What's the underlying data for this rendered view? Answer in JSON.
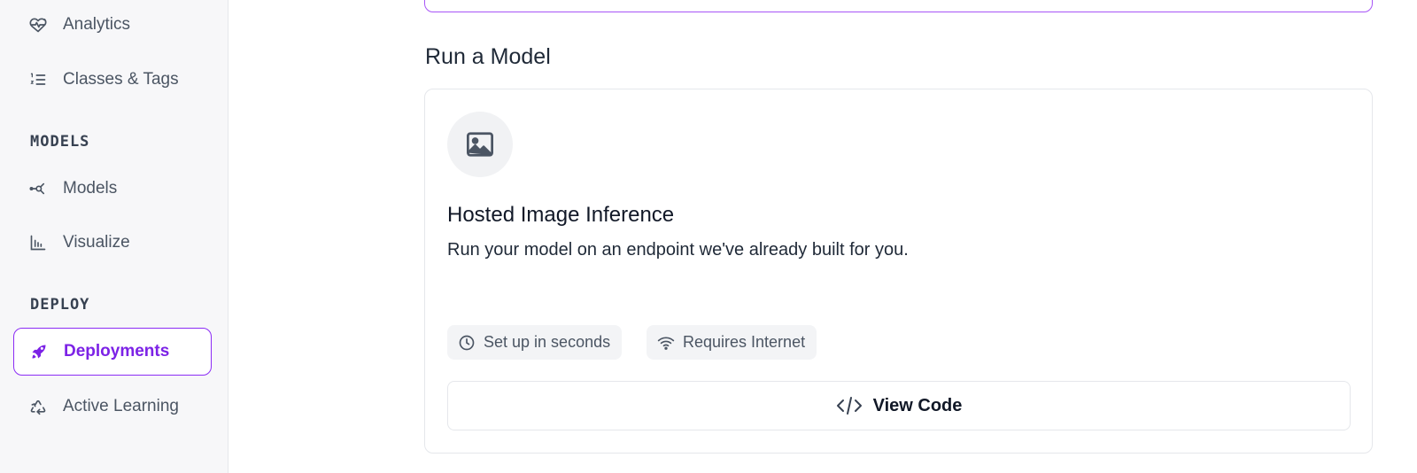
{
  "sidebar": {
    "items_top": [
      {
        "label": "Analytics",
        "icon": "heart-pulse-icon"
      },
      {
        "label": "Classes & Tags",
        "icon": "numbered-list-icon"
      }
    ],
    "sections": [
      {
        "heading": "MODELS",
        "items": [
          {
            "label": "Models",
            "icon": "network-nodes-icon"
          },
          {
            "label": "Visualize",
            "icon": "bar-chart-icon"
          }
        ]
      },
      {
        "heading": "DEPLOY",
        "items": [
          {
            "label": "Deployments",
            "icon": "rocket-icon",
            "active": true
          },
          {
            "label": "Active Learning",
            "icon": "recycle-icon"
          }
        ]
      }
    ]
  },
  "main": {
    "section_title": "Run a Model",
    "card": {
      "icon": "image-icon",
      "title": "Hosted Image Inference",
      "description": "Run your model on an endpoint we've already built for you.",
      "chips": [
        {
          "label": "Set up in seconds",
          "icon": "clock-icon"
        },
        {
          "label": "Requires Internet",
          "icon": "wifi-icon"
        }
      ],
      "button_label": "View Code",
      "button_icon": "code-icon"
    }
  },
  "colors": {
    "accent": "#7c22e6",
    "accent_border": "#8b2cf5",
    "sidebar_bg": "#f7f7f9"
  }
}
